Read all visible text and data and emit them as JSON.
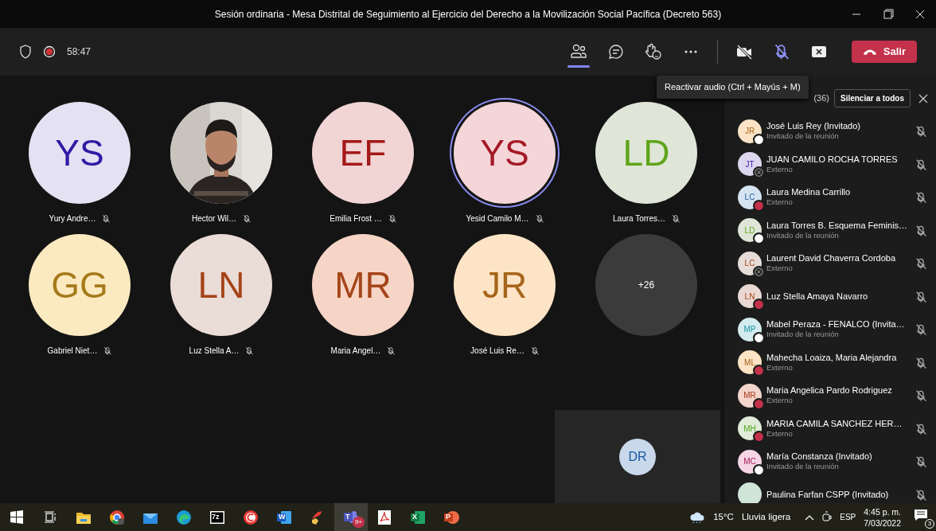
{
  "window": {
    "title": "Sesión ordinaria - Mesa Distrital de Seguimiento al Ejercicio del Derecho a la Movilización Social Pacífica (Decreto 563)"
  },
  "toolbar": {
    "timer": "58:47",
    "recording": true,
    "tools": [
      {
        "kind": "people",
        "selected": true
      },
      {
        "kind": "chat",
        "selected": false
      },
      {
        "kind": "react",
        "selected": false
      },
      {
        "kind": "more",
        "selected": false
      }
    ],
    "camera_on": false,
    "mic_muted": true,
    "leave_label": "Salir"
  },
  "tooltip": "Reactivar audio (Ctrl + Mayús + M)",
  "tiles": [
    {
      "kind": "avatar",
      "initials": "YS",
      "color": "#e4e1f2",
      "name": "Yury Andre…",
      "speaking": false
    },
    {
      "kind": "picture",
      "name": "Hector Wil…",
      "speaking": false
    },
    {
      "kind": "avatar",
      "initials": "EF",
      "color": "#f1d4d4",
      "name": "Emilia Frost …",
      "speaking": false
    },
    {
      "kind": "avatar",
      "initials": "YS",
      "color": "#f4d6d9",
      "name": "Yesid Camilo M…",
      "speaking": true
    },
    {
      "kind": "avatar",
      "initials": "LD",
      "color": "#dfe6d8",
      "name": "Laura Torres…",
      "speaking": false
    },
    {
      "kind": "avatar",
      "initials": "GG",
      "color": "#fbe9c0",
      "name": "Gabriel Niet…",
      "speaking": false
    },
    {
      "kind": "avatar",
      "initials": "LN",
      "color": "#eadcd6",
      "name": "Luz Stella A…",
      "speaking": false
    },
    {
      "kind": "avatar",
      "initials": "MR",
      "color": "#f6d5c6",
      "name": "Maria Angel…",
      "speaking": false
    },
    {
      "kind": "avatar",
      "initials": "JR",
      "color": "#fde4c6",
      "name": "José Luis Re…",
      "speaking": false
    },
    {
      "kind": "overflow",
      "initials": "+26"
    }
  ],
  "self_view": {
    "initials": "DR",
    "color": "#c9d8ea"
  },
  "panel": {
    "count": "(36)",
    "mute_all": "Silenciar a todos",
    "participants": [
      {
        "initials": "JR",
        "color": "#fde3c5",
        "name": "José Luis Rey (Invitado)",
        "role": "Invitado de la reunión",
        "kind": "available"
      },
      {
        "initials": "JT",
        "color": "#dcd7ee",
        "name": "JUAN CAMILO ROCHA TORRES",
        "role": "Externo",
        "kind": "offline"
      },
      {
        "initials": "LC",
        "color": "#d6e4f1",
        "name": "Laura Medina Carrillo",
        "role": "Externo",
        "kind": "busy"
      },
      {
        "initials": "LD",
        "color": "#dfe6d8",
        "name": "Laura Torres B. Esquema Feminis…",
        "role": "Invitado de la reunión",
        "kind": "available"
      },
      {
        "initials": "LC",
        "color": "#e6dcd8",
        "name": "Laurent David Chaverra Cordoba",
        "role": "Externo",
        "kind": "offline"
      },
      {
        "initials": "LN",
        "color": "#ead9d2",
        "name": "Luz Stella Amaya Navarro",
        "kind": "busy"
      },
      {
        "initials": "MP",
        "color": "#d4ecef",
        "name": "Mabel Peraza - FENALCO (Invita…",
        "role": "Invitado de la reunión",
        "kind": "available"
      },
      {
        "initials": "ML",
        "color": "#fde3c5",
        "name": "Mahecha Loaiza, Maria Alejandra",
        "role": "Externo",
        "kind": "busy"
      },
      {
        "initials": "MR",
        "color": "#f3d5cc",
        "name": "Maria Angelica Pardo Rodriguez",
        "role": "Externo",
        "kind": "busy"
      },
      {
        "initials": "MH",
        "color": "#e0ecd8",
        "name": "MARIA CAMILA SANCHEZ HER…",
        "role": "Externo",
        "kind": "busy"
      },
      {
        "initials": "MC",
        "color": "#f5d5e4",
        "name": "María Constanza (Invitado)",
        "role": "Invitado de la reunión",
        "kind": "available"
      },
      {
        "color": "#d0e5d8",
        "name": "Paulina Farfan CSPP (Invitado)"
      }
    ]
  },
  "taskbar": {
    "apps": [
      {
        "kind": "start",
        "active": false
      },
      {
        "kind": "taskview",
        "active": false
      },
      {
        "kind": "folder",
        "active": false
      },
      {
        "kind": "chrome",
        "active": false
      },
      {
        "kind": "mail",
        "active": false
      },
      {
        "kind": "edge",
        "active": false
      },
      {
        "kind": "sevenzip",
        "glyph": "7z",
        "active": false
      },
      {
        "kind": "redc",
        "active": false
      },
      {
        "kind": "word",
        "glyph": "W",
        "active": false
      },
      {
        "kind": "brush",
        "active": false
      },
      {
        "kind": "teams",
        "glyph": "T",
        "badge": "9+",
        "active": true
      },
      {
        "kind": "acrobat",
        "active": false
      },
      {
        "kind": "excel",
        "glyph": "X",
        "active": false
      },
      {
        "kind": "powerpoint",
        "glyph": "P",
        "active": false
      }
    ],
    "temperature": "15°C",
    "weather": "Lluvia ligera",
    "language": "ESP",
    "time": "4:45 p. m.",
    "date": "7/03/2022",
    "notifications": "3"
  }
}
